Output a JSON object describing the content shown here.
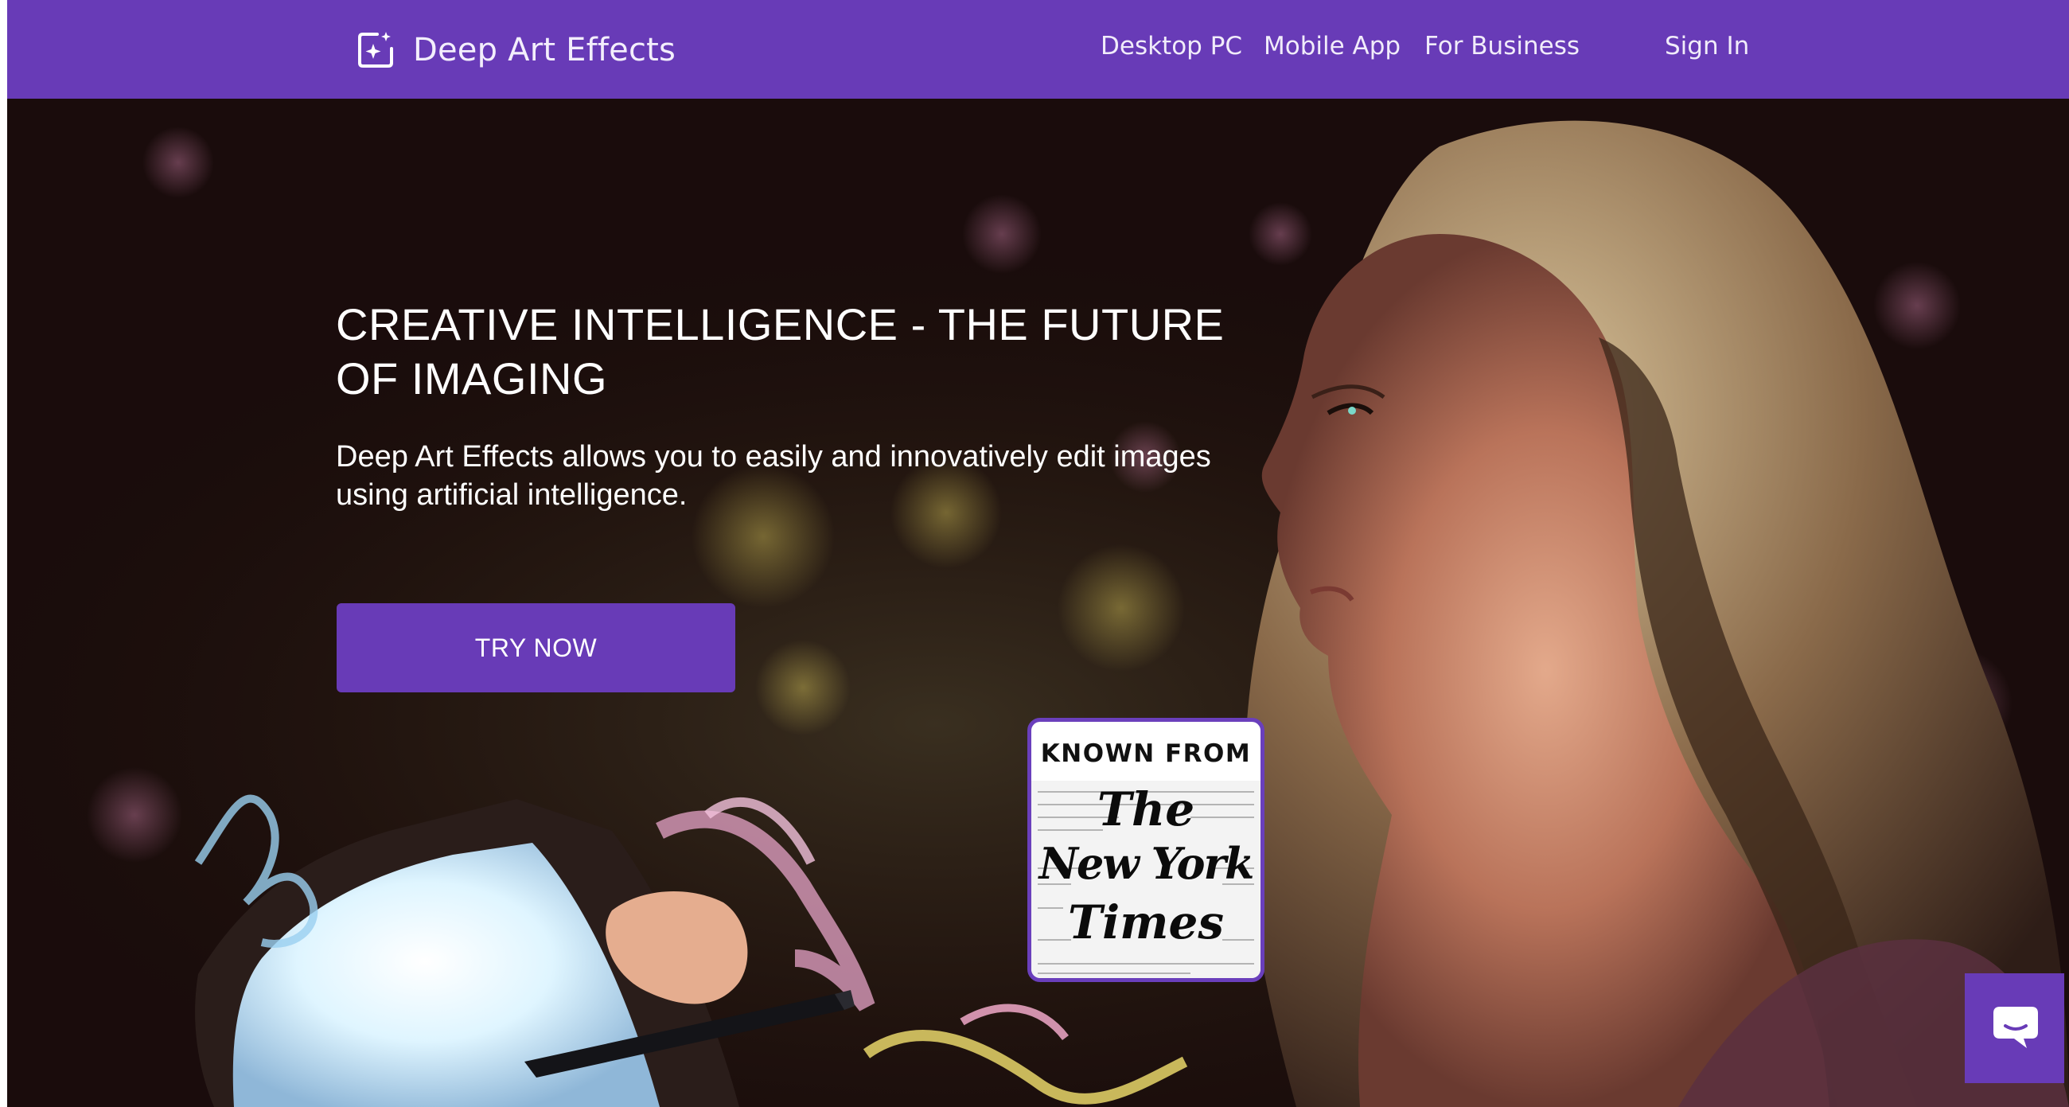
{
  "header": {
    "brand_name": "Deep Art Effects",
    "nav": [
      {
        "label": "Desktop PC"
      },
      {
        "label": "Mobile App"
      },
      {
        "label": "For Business"
      },
      {
        "label": "Sign In"
      }
    ]
  },
  "hero": {
    "title_line_1": "CREATIVE INTELLIGENCE - THE FUTURE",
    "title_line_2": "OF IMAGING",
    "subtitle_line_1": "Deep Art Effects allows you to easily and innovatively edit images",
    "subtitle_line_2": "using artificial intelligence.",
    "cta_label": "TRY NOW"
  },
  "press": {
    "label": "KNOWN FROM",
    "logo_lines": [
      "The",
      "New York",
      "Times"
    ]
  },
  "icons": {
    "brand": "sparkle-frame-icon",
    "chat": "chat-bubble-icon"
  },
  "colors": {
    "brand_purple": "#683bb7",
    "hero_background": "#1a0c0c",
    "text_light": "#ffffff"
  }
}
